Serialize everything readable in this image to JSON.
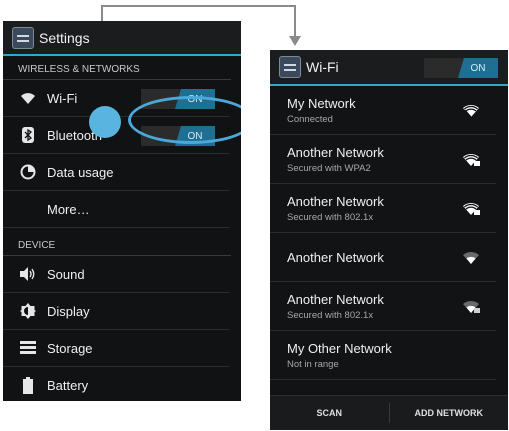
{
  "left": {
    "title": "Settings",
    "sections": {
      "wireless": "WIRELESS & NETWORKS",
      "device": "DEVICE"
    },
    "rows": {
      "wifi": {
        "label": "Wi-Fi",
        "toggle": "ON",
        "icon": "wifi-icon"
      },
      "bluetooth": {
        "label": "Bluetooth",
        "toggle": "ON",
        "icon": "bluetooth-icon"
      },
      "data_usage": {
        "label": "Data usage",
        "icon": "data-usage-icon"
      },
      "more": {
        "label": "More…"
      },
      "sound": {
        "label": "Sound",
        "icon": "volume-icon"
      },
      "display": {
        "label": "Display",
        "icon": "brightness-icon"
      },
      "storage": {
        "label": "Storage",
        "icon": "storage-icon"
      },
      "battery": {
        "label": "Battery",
        "icon": "battery-icon"
      }
    }
  },
  "right": {
    "title": "Wi-Fi",
    "toggle": "ON",
    "networks": [
      {
        "name": "My Network",
        "status": "Connected",
        "signal": "full",
        "locked": false
      },
      {
        "name": "Another Network",
        "status": "Secured with WPA2",
        "signal": "full",
        "locked": true
      },
      {
        "name": "Another Network",
        "status": "Secured with 802.1x",
        "signal": "full",
        "locked": true
      },
      {
        "name": "Another Network",
        "status": "",
        "signal": "weak",
        "locked": false
      },
      {
        "name": "Another Network",
        "status": "Secured with 802.1x",
        "signal": "weak",
        "locked": true
      },
      {
        "name": "My Other Network",
        "status": "Not in range",
        "signal": "none",
        "locked": false
      }
    ],
    "bottom": {
      "scan": "SCAN",
      "add": "ADD NETWORK"
    }
  },
  "colors": {
    "accent": "#2fa7cf",
    "switch_on": "#1f6f92",
    "touch": "#5ab4e0",
    "background": "#111214"
  }
}
